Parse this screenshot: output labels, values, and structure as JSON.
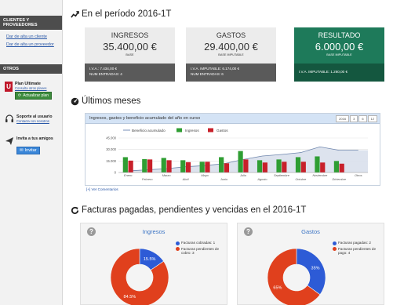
{
  "sidebar": {
    "section1_title": "CLIENTES Y PROVEEDORES",
    "links": [
      "Dar de alta un cliente",
      "Dar de alta un proveedor"
    ],
    "section2_title": "OTROS",
    "plan": {
      "title": "Plan Ultimate",
      "link": "Consulta otros planes",
      "button": "Actualizar plan"
    },
    "support": {
      "title": "Soporte al usuario",
      "link": "Contacta con nosotros"
    },
    "invite": {
      "title": "Invita a tus amigos",
      "button": "Invitar"
    }
  },
  "period": {
    "title": "En el período 2016-1T"
  },
  "kpis": [
    {
      "title": "INGRESOS",
      "amount": "35.400,00 €",
      "sub": "BASE",
      "line1": "I.V.A.: 7.434,00 €",
      "line2": "NUM ENTRADAS: 4"
    },
    {
      "title": "GASTOS",
      "amount": "29.400,00 €",
      "sub": "BASE IMPUTABLE",
      "line1": "I.V.A. IMPUTABLE: 6.174,00 €",
      "line2": "NUM ENTRADAS: 6"
    },
    {
      "title": "RESULTADO",
      "amount": "6.000,00 €",
      "sub": "BASE IMPUTABLE",
      "line1": "I.V.A. IMPUTABLE: 1.260,00 €",
      "line2": ""
    }
  ],
  "months_section": {
    "title": "Últimos meses",
    "chart_header": "Ingresos, gastos y beneficio acumulado del año en curso",
    "controls": [
      "2016",
      "3",
      "6",
      "12"
    ],
    "comments_link": "[+] Ver Comentarios"
  },
  "pending_section": {
    "title": "Facturas pagadas, pendientes y vencidas en el 2016-1T"
  },
  "pie_cards": [
    {
      "title": "Ingresos",
      "legend": [
        "Facturas cobradas: 1",
        "Facturas pendientes de cobro: 3"
      ]
    },
    {
      "title": "Gastos",
      "legend": [
        "Facturas pagadas: 2",
        "Facturas pendientes de pago: 4"
      ]
    }
  ],
  "colors": {
    "ingresos": "#2f9e33",
    "gastos": "#c8202a",
    "beneficio": "#8fa4c4",
    "pie_blue": "#2d5bd6",
    "pie_red": "#e0401d",
    "result_green": "#1e7a5a"
  },
  "chart_data": [
    {
      "type": "bar",
      "title": "Ingresos, gastos y beneficio acumulado del año en curso",
      "categories": [
        "Enero",
        "Febrero",
        "Marzo",
        "Abril",
        "Mayo",
        "Junio",
        "Julio",
        "Agosto",
        "Septiembre",
        "Octubre",
        "Noviembre",
        "Diciembre",
        "Otros"
      ],
      "yticks": [
        "45.000",
        "30.000",
        "15.000",
        "0"
      ],
      "ylim": [
        0,
        45000
      ],
      "series": [
        {
          "name": "Beneficio acumulado",
          "type": "area",
          "values": [
            2000,
            3500,
            5000,
            7500,
            9000,
            11500,
            17000,
            21500,
            23500,
            26000,
            33500,
            29000,
            29000
          ]
        },
        {
          "name": "Ingresos",
          "type": "bar",
          "values": [
            20000,
            17500,
            19000,
            16000,
            14000,
            20000,
            28000,
            16000,
            17000,
            20000,
            21000,
            15000,
            0
          ]
        },
        {
          "name": "Gastos",
          "type": "bar",
          "values": [
            15500,
            17000,
            16000,
            13500,
            14000,
            12000,
            17000,
            13000,
            14000,
            14000,
            13000,
            11500,
            0
          ]
        }
      ],
      "legend_position": "top",
      "grid": true
    },
    {
      "type": "pie",
      "title": "Ingresos",
      "labels": [
        "Facturas cobradas",
        "Facturas pendientes de cobro"
      ],
      "values": [
        15.5,
        84.5
      ],
      "value_labels": [
        "15.5%",
        "84.5%"
      ]
    },
    {
      "type": "pie",
      "title": "Gastos",
      "labels": [
        "Facturas pagadas",
        "Facturas pendientes de pago"
      ],
      "values": [
        35,
        65
      ],
      "value_labels": [
        "35%",
        "65%"
      ]
    }
  ]
}
